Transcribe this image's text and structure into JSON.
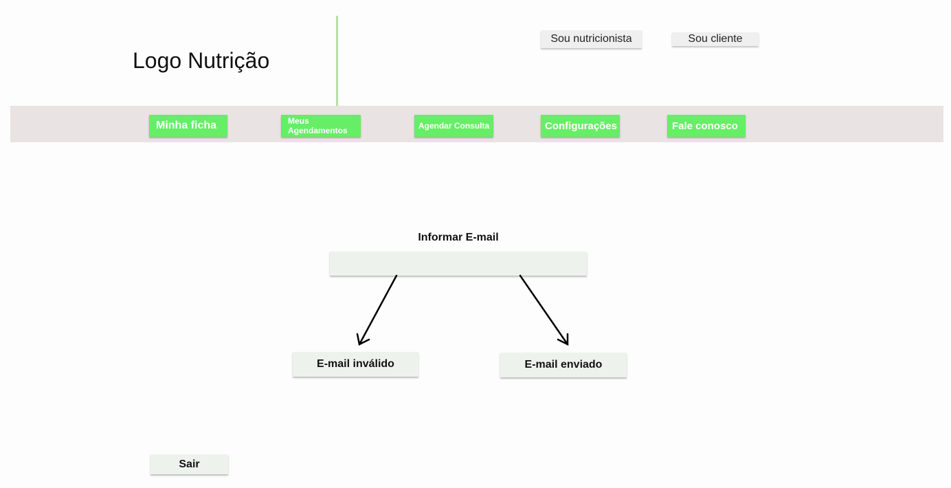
{
  "header": {
    "logo_text": "Logo Nutrição",
    "role_buttons": {
      "nutritionist": "Sou nutricionista",
      "client": "Sou cliente"
    }
  },
  "nav": {
    "items": [
      {
        "label": "Minha ficha"
      },
      {
        "label": "Meus Agendamentos"
      },
      {
        "label": "Agendar Consulta"
      },
      {
        "label": "Configurações"
      },
      {
        "label": "Fale conosco"
      }
    ]
  },
  "main": {
    "email_label": "Informar E-mail",
    "email_input": {
      "value": "",
      "placeholder": ""
    },
    "results": {
      "invalid": "E-mail inválido",
      "sent": "E-mail enviado"
    }
  },
  "footer": {
    "logout_label": "Sair"
  },
  "colors": {
    "nav_button": "#66ee66",
    "nav_bar": "#e9e3e3",
    "panel": "#edf3ec",
    "divider": "#b9deaa"
  }
}
